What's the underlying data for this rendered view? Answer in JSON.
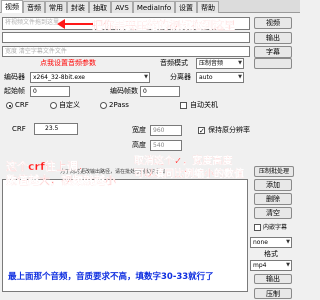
{
  "tabs": [
    {
      "label": "视频"
    },
    {
      "label": "音频"
    },
    {
      "label": "常用"
    },
    {
      "label": "封装"
    },
    {
      "label": "抽取"
    },
    {
      "label": "AVS"
    },
    {
      "label": "MediaInfo"
    },
    {
      "label": "设置"
    },
    {
      "label": "帮助"
    }
  ],
  "source": {
    "placeholder": "将视频文件拖到这里"
  },
  "output": {
    "placeholder": "宽度 清空字幕文件文件"
  },
  "buttons": {
    "video": "视频",
    "output": "输出",
    "subtitle": "字幕",
    "add": "添加",
    "remove": "删除",
    "clear": "清空",
    "subtitle_batch": "压制批处理",
    "output2": "输出",
    "compress": "压制"
  },
  "encoder": {
    "audio_settings_link": "点我设置音频参数",
    "encoder_label": "编码器",
    "encoder_value": "x264_32-8bit.exe",
    "audio_mode_label": "音频模式",
    "audio_mode_value": "压制音频",
    "splitter_label": "分离器",
    "splitter_value": "auto",
    "start_frame_label": "起始帧",
    "start_frame_value": "0",
    "frames_label": "编码帧数",
    "frames_value": "0",
    "rate_modes": [
      "CRF",
      "自定义",
      "2Pass"
    ],
    "auto_shutdown": "自动关机"
  },
  "crf": {
    "label": "CRF",
    "value": "23.5",
    "width_label": "宽度",
    "width_value": "960",
    "height_label": "高度",
    "height_value": "540",
    "keep_ratio": "保持原分辨率"
  },
  "batch": {
    "hint": "为了同时更改输出路径，请在批处理列表中添加",
    "format_label": "格式",
    "format_options_selected": "none",
    "container_value": "mp4",
    "content_subtitle": "内嵌字幕"
  },
  "annotations": {
    "drag_here": "把你需要压缩的视频拖到这里",
    "crf_line1": "这个crf往上调，",
    "crf_line2": "数值越大，视频就越小",
    "resize_line1": "取消这个✓，宽度高度",
    "resize_line2": "可以填同比例缩小的数值",
    "audio_note": "最上面那个音频，音质要求不高，填数字30-33就行了"
  },
  "colors": {
    "annotation_red": "#ff1a1a",
    "annotation_blue": "#1030e0",
    "window_bg": "#f0f0f0"
  }
}
